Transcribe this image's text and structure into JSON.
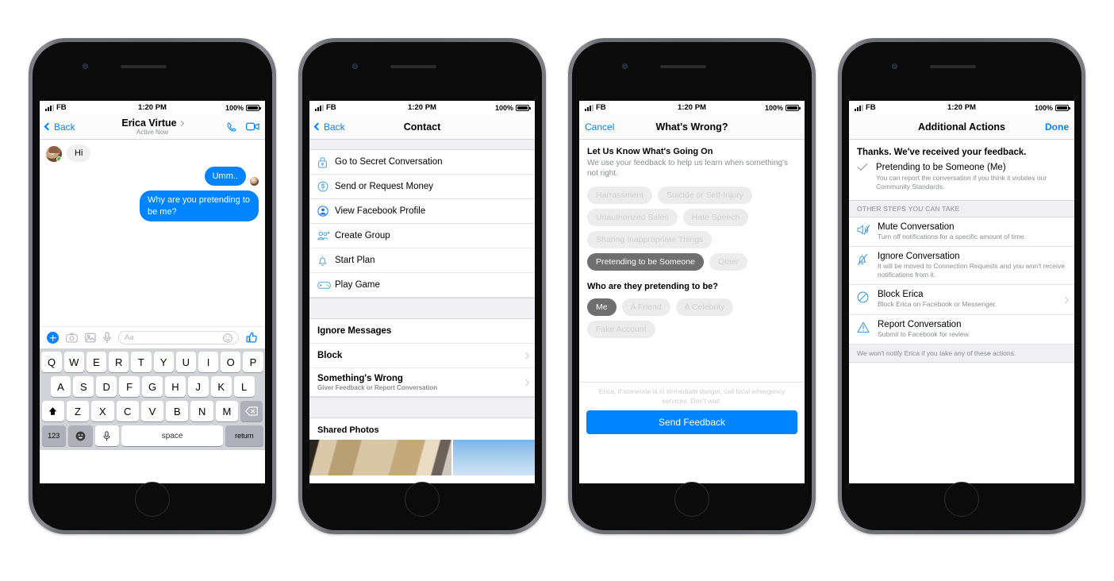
{
  "colors": {
    "accent": "#0084ff",
    "muted": "#8a8d91",
    "chip_selected_bg": "#6f6f6f",
    "chip_bg": "#ececec",
    "online_dot": "#42b72a"
  },
  "status_bar": {
    "carrier": "FB",
    "time": "1:20 PM",
    "battery": "100%"
  },
  "phone1": {
    "nav": {
      "back": "Back",
      "title": "Erica Virtue",
      "subtitle": "Active Now",
      "call_icon": "phone-icon",
      "video_icon": "video-camera-icon"
    },
    "messages": [
      {
        "side": "in",
        "text": "Hi",
        "avatar": true
      },
      {
        "side": "out",
        "text": "Umm.."
      },
      {
        "side": "out",
        "text": "Why are you pretending to be me?"
      }
    ],
    "composer": {
      "plus_icon": "plus-icon",
      "camera_icon": "camera-icon",
      "photo_icon": "photo-icon",
      "mic_icon": "microphone-icon",
      "placeholder": "Aa",
      "emoji_icon": "smiley-icon",
      "like_icon": "thumbs-up-icon"
    },
    "keyboard": {
      "row1": [
        "Q",
        "W",
        "E",
        "R",
        "T",
        "Y",
        "U",
        "I",
        "O",
        "P"
      ],
      "row2": [
        "A",
        "S",
        "D",
        "F",
        "G",
        "H",
        "J",
        "K",
        "L"
      ],
      "row3": [
        "Z",
        "X",
        "C",
        "V",
        "B",
        "N",
        "M"
      ],
      "shift_icon": "shift-icon",
      "backspace_icon": "backspace-icon",
      "numbers": "123",
      "emoji_icon": "emoji-icon",
      "mic_icon": "microphone-icon",
      "space": "space",
      "return": "return"
    }
  },
  "phone2": {
    "nav": {
      "back": "Back",
      "title": "Contact"
    },
    "items": [
      {
        "label": "Go to Secret Conversation",
        "icon": "lock-icon"
      },
      {
        "label": "Send or Request Money",
        "icon": "dollar-circle-icon"
      },
      {
        "label": "View Facebook Profile",
        "icon": "person-circle-icon"
      },
      {
        "label": "Create Group",
        "icon": "group-add-icon"
      },
      {
        "label": "Start Plan",
        "icon": "bell-icon"
      },
      {
        "label": "Play Game",
        "icon": "game-controller-icon"
      }
    ],
    "actions": [
      {
        "label": "Ignore Messages",
        "sub": "",
        "chevron": false
      },
      {
        "label": "Block",
        "sub": "",
        "chevron": true
      },
      {
        "label": "Something's Wrong",
        "sub": "Giver Feedback or Report Conversation",
        "chevron": true
      }
    ],
    "shared_photos_title": "Shared Photos"
  },
  "phone3": {
    "nav": {
      "cancel": "Cancel",
      "title": "What's Wrong?"
    },
    "heading": "Let Us Know What's Going On",
    "paragraph": "We use your feedback to help us learn when something's not right.",
    "reason_chips": [
      {
        "label": "Harrassment",
        "selected": false
      },
      {
        "label": "Suicide or Self-Injury",
        "selected": false
      },
      {
        "label": "Unauthorized Sales",
        "selected": false
      },
      {
        "label": "Hate Speech",
        "selected": false
      },
      {
        "label": "Sharing Inappropriate Things",
        "selected": false
      },
      {
        "label": "Pretending to be Someone",
        "selected": true
      },
      {
        "label": "Other",
        "selected": false
      }
    ],
    "subheading": "Who are they pretending to be?",
    "target_chips": [
      {
        "label": "Me",
        "selected": true
      },
      {
        "label": "A Friend",
        "selected": false
      },
      {
        "label": "A Celebrity",
        "selected": false
      },
      {
        "label": "Fake Account",
        "selected": false
      }
    ],
    "note": "Erica, if someone is in immediate danger, call local emergency services. Don't wait.",
    "submit": "Send Feedback"
  },
  "phone4": {
    "nav": {
      "title": "Additional Actions",
      "done": "Done"
    },
    "heading": "Thanks. We've received your feedback.",
    "ack": {
      "check_icon": "check-icon",
      "title": "Pretending to be Someone (Me)",
      "subtitle": "You can report the conversation if you think it violates our Community Standards."
    },
    "section_header": "OTHER STEPS YOU CAN TAKE",
    "actions": [
      {
        "icon": "mute-speaker-icon",
        "title": "Mute Conversation",
        "subtitle": "Turn off notifications for a specific amount of time.",
        "chevron": false
      },
      {
        "icon": "bell-slash-icon",
        "title": "Ignore Conversation",
        "subtitle": "It will be moved to Connection Requests and you won't receive notifications from it.",
        "chevron": false
      },
      {
        "icon": "block-circle-icon",
        "title": "Block Erica",
        "subtitle": "Block Erica on Facebook or Messenger.",
        "chevron": true
      },
      {
        "icon": "warning-triangle-icon",
        "title": "Report Conversation",
        "subtitle": "Submit to Facebook for review.",
        "chevron": false
      }
    ],
    "footer_note": "We won't notify Erica if you take any of these actions."
  }
}
